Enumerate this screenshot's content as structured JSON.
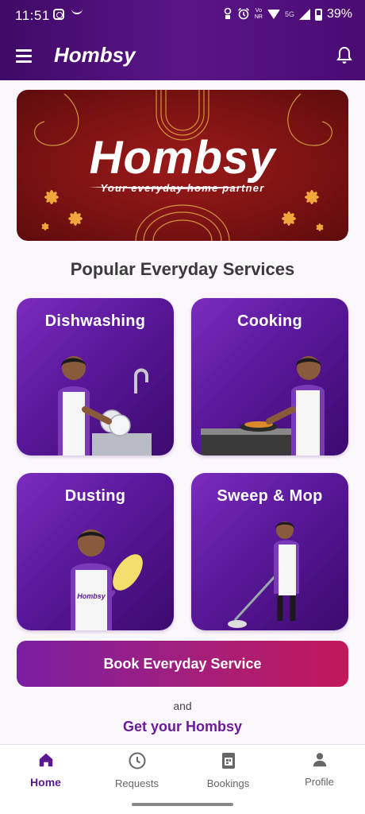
{
  "status_bar": {
    "time": "11:51",
    "battery": "39%",
    "net_label_top": "Vo",
    "net_label_bottom": "NR",
    "signal_label": "5G"
  },
  "app_bar": {
    "title": "Hombsy",
    "menu_icon": "hamburger-menu-icon",
    "notification_icon": "bell-icon"
  },
  "banner": {
    "title": "Hombsy",
    "tagline": "Your everyday home partner"
  },
  "section_title": "Popular Everyday Services",
  "services": [
    {
      "label": "Dishwashing"
    },
    {
      "label": "Cooking"
    },
    {
      "label": "Dusting"
    },
    {
      "label": "Sweep & Mop"
    }
  ],
  "uniform_text": "Hombsy",
  "cta": {
    "label": "Book Everyday Service",
    "and_text": "and",
    "link_text": "Get your Hombsy"
  },
  "bottom_nav": [
    {
      "label": "Home",
      "icon": "home-icon",
      "active": true
    },
    {
      "label": "Requests",
      "icon": "clock-icon",
      "active": false
    },
    {
      "label": "Bookings",
      "icon": "calendar-icon",
      "active": false
    },
    {
      "label": "Profile",
      "icon": "person-icon",
      "active": false
    }
  ],
  "colors": {
    "primary": "#5b1892",
    "banner": "#7a1212",
    "accent": "#c2185b"
  }
}
